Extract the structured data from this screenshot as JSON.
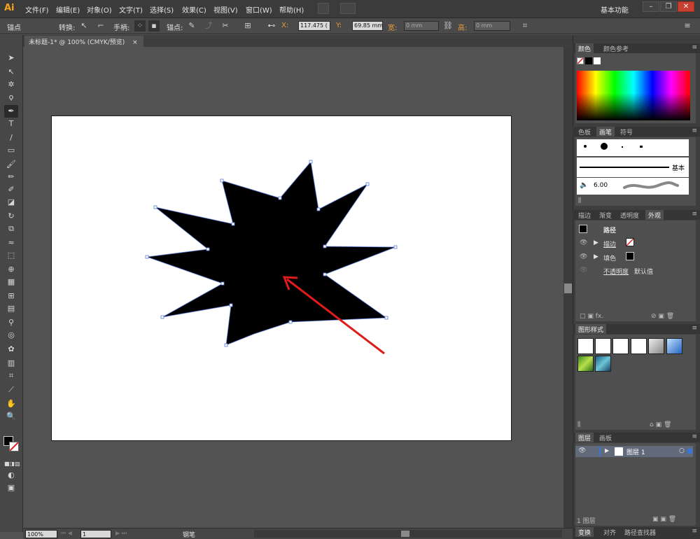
{
  "app": {
    "logo": "Ai",
    "workspace": "基本功能",
    "window_controls": [
      "–",
      "❐",
      "✕"
    ]
  },
  "menu": [
    "文件(F)",
    "编辑(E)",
    "对象(O)",
    "文字(T)",
    "选择(S)",
    "效果(C)",
    "视图(V)",
    "窗口(W)",
    "帮助(H)"
  ],
  "control_bar": {
    "selection_label": "锚点",
    "convert_label": "转换:",
    "handles_label": "手柄:",
    "anchor_label": "锚点:",
    "x_label": "X:",
    "x_value": "117.475 (",
    "y_label": "Y:",
    "y_value": "69.85 mm",
    "w_label": "宽:",
    "w_value": "0 mm",
    "h_label": "高:",
    "h_value": "0 mm"
  },
  "document": {
    "tab_title": "未标题-1* @ 100% (CMYK/预览)",
    "close": "×"
  },
  "status_bar": {
    "zoom": "100%",
    "artboard": "1",
    "tool": "钢笔"
  },
  "panels": {
    "color": {
      "tabs": [
        "颜色",
        "颜色参考"
      ]
    },
    "brushes": {
      "tabs": [
        "色板",
        "画笔",
        "符号"
      ],
      "basic_label": "基本",
      "size_label": "6.00"
    },
    "appearance": {
      "tabs": [
        "描边",
        "渐变",
        "透明度",
        "外观"
      ],
      "title": "路径",
      "stroke_label": "描边",
      "fill_label": "填色",
      "opacity_label": "不透明度",
      "opacity_value": "默认值"
    },
    "graphic_styles": {
      "tabs": [
        "图形样式"
      ]
    },
    "layers": {
      "tabs": [
        "图层",
        "画板"
      ],
      "layer_name": "图层 1",
      "bottom_label": "1 图层"
    },
    "bottom": {
      "tabs": [
        "变换",
        "对齐",
        "路径查找器"
      ]
    }
  },
  "colors": {
    "accent_orange": "#e59b3a",
    "arrow_red": "#e01b1b",
    "path_outline": "#5a7bd6"
  }
}
